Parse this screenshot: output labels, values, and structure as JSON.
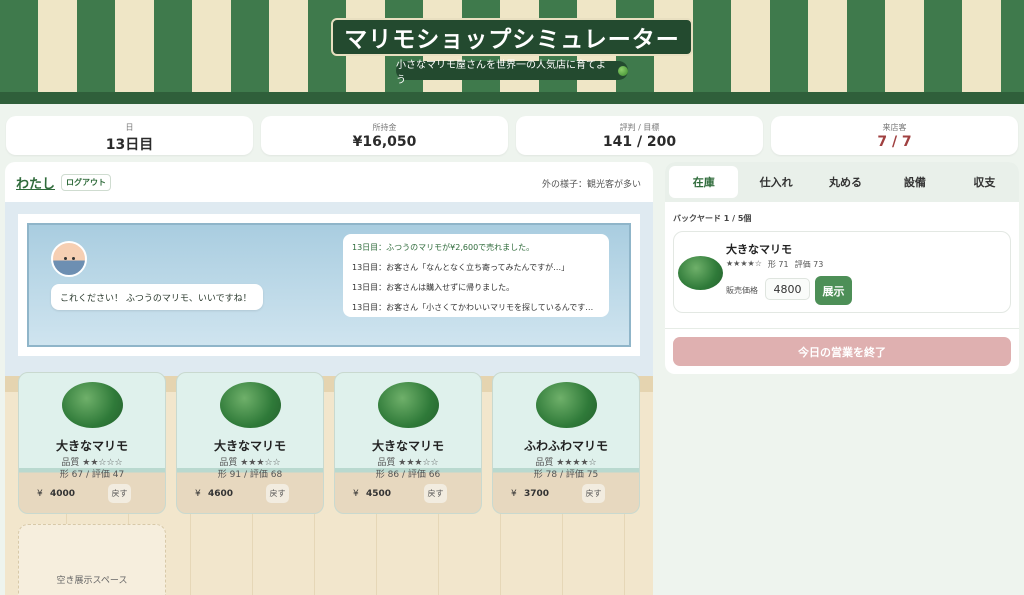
{
  "header": {
    "title": "マリモショップシミュレーター",
    "subtitle": "小さなマリモ屋さんを世界一の人気店に育てよう"
  },
  "stats": {
    "day_label": "日",
    "day_value": "13日目",
    "money_label": "所持金",
    "money_value": "¥16,050",
    "rating_label": "評判 / 目標",
    "rating_value": "141 / 200",
    "visitors_label": "来店客",
    "visitors_value": "7 / 7"
  },
  "shop": {
    "user_name": "わたし",
    "logout_label": "ログアウト",
    "outside_status": "外の様子：観光客が多い",
    "speech": "これください！ ふつうのマリモ、いいですね！",
    "log": [
      "13日目：ふつうのマリモが¥2,600で売れました。",
      "13日目：お客さん「なんとなく立ち寄ってみたんですが…」",
      "13日目：お客さんは購入せずに帰りました。",
      "13日目：お客さん「小さくてかわいいマリモを探しているんです…"
    ],
    "cards": [
      {
        "name": "大きなマリモ",
        "quality": "品質 ★★☆☆☆",
        "detail": "形 67 / 評価 47",
        "currency": "¥",
        "price": "4000",
        "back_label": "戻す"
      },
      {
        "name": "大きなマリモ",
        "quality": "品質 ★★★☆☆",
        "detail": "形 91 / 評価 68",
        "currency": "¥",
        "price": "4600",
        "back_label": "戻す"
      },
      {
        "name": "大きなマリモ",
        "quality": "品質 ★★★☆☆",
        "detail": "形 86 / 評価 66",
        "currency": "¥",
        "price": "4500",
        "back_label": "戻す"
      },
      {
        "name": "ふわふわマリモ",
        "quality": "品質 ★★★★☆",
        "detail": "形 78 / 評価 75",
        "currency": "¥",
        "price": "3700",
        "back_label": "戻す"
      }
    ],
    "empty_slot_label": "空き展示スペース"
  },
  "panel": {
    "tabs": [
      "在庫",
      "仕入れ",
      "丸める",
      "設備",
      "収支"
    ],
    "active_tab": 0,
    "backyard_label": "バックヤード 1 / 5個",
    "item": {
      "name": "大きなマリモ",
      "stars": "★★★★☆",
      "shape": "形 71",
      "rating": "評価 73",
      "price_label": "販売価格",
      "price_value": "4800",
      "display_label": "展示"
    },
    "end_day_label": "今日の営業を終了"
  },
  "colors": {
    "brand_green": "#3f7a4c",
    "awning_cream": "#efe6c6",
    "button_green": "#4d8f57",
    "end_button": "#dfb0b0",
    "visitors_red": "#a04040"
  }
}
